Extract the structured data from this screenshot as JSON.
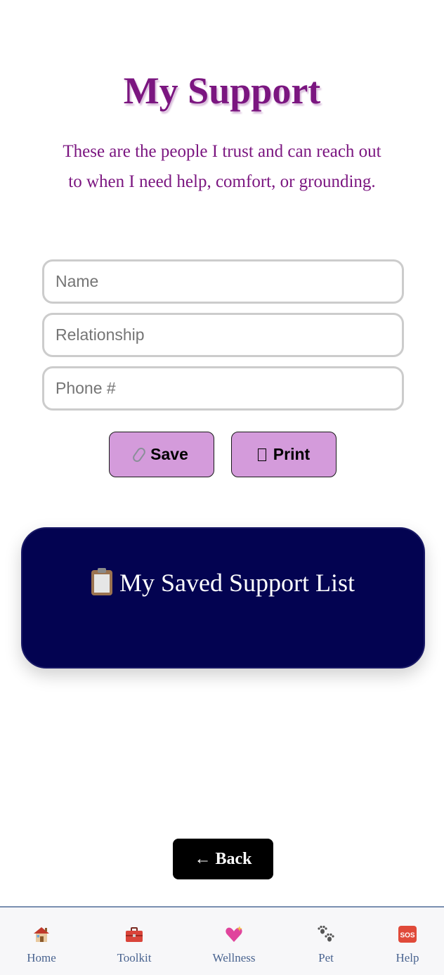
{
  "page": {
    "title": "My Support",
    "intro": "These are the people I trust and can reach out to when I need help, comfort, or grounding."
  },
  "form": {
    "name_placeholder": "Name",
    "relationship_placeholder": "Relationship",
    "phone_placeholder": "Phone #",
    "save_label": "Save",
    "save_icon": "paperclip-icon",
    "print_label": "Print",
    "print_icon": "missing-glyph-icon"
  },
  "saved_list": {
    "title": "My Saved Support List",
    "icon": "clipboard-icon"
  },
  "back_label": "← Back",
  "nav": {
    "items": [
      {
        "label": "Home",
        "icon": "house-icon"
      },
      {
        "label": "Toolkit",
        "icon": "toolbox-icon"
      },
      {
        "label": "Wellness",
        "icon": "sparkling-heart-icon"
      },
      {
        "label": "Pet",
        "icon": "paw-prints-icon"
      },
      {
        "label": "Help",
        "icon": "sos-icon"
      }
    ]
  },
  "colors": {
    "accent_purple": "#7b1680",
    "button_fill": "#d49bdb",
    "card_navy": "#030351",
    "nav_text": "#4a6490"
  }
}
